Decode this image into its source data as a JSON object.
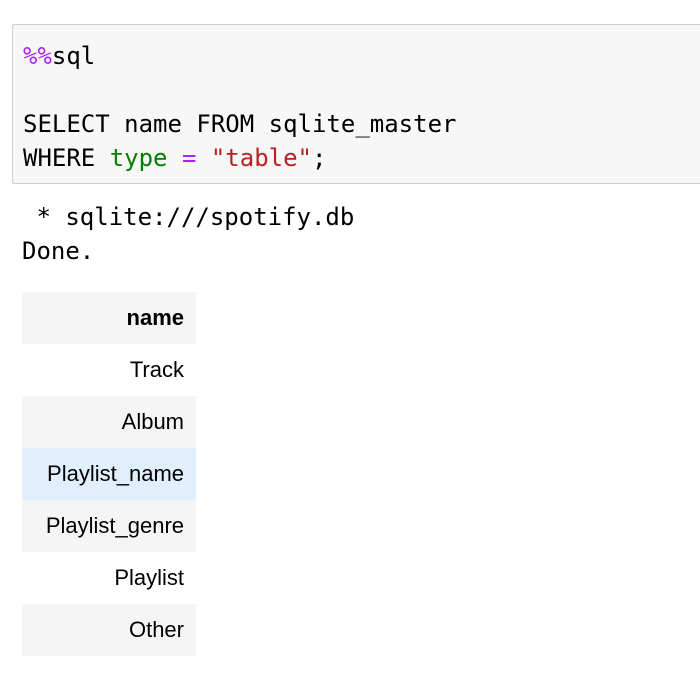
{
  "cell": {
    "magic_prefix": "%%",
    "magic_name": "sql",
    "line2_a": "SELECT name FROM sqlite_master",
    "line3_where": "WHERE ",
    "line3_type": "type",
    "line3_eq": "=",
    "line3_str": "\"table\"",
    "line3_end": ";"
  },
  "output": {
    "connection": " * sqlite:///spotify.db",
    "status": "Done."
  },
  "table": {
    "header": "name",
    "rows": [
      "Track",
      "Album",
      "Playlist_name",
      "Playlist_genre",
      "Playlist",
      "Other"
    ]
  },
  "colors": {
    "magic": "#aa22ff",
    "keyword_green": "#008000",
    "string": "#ba2121",
    "row_highlight": "#e1effc"
  }
}
